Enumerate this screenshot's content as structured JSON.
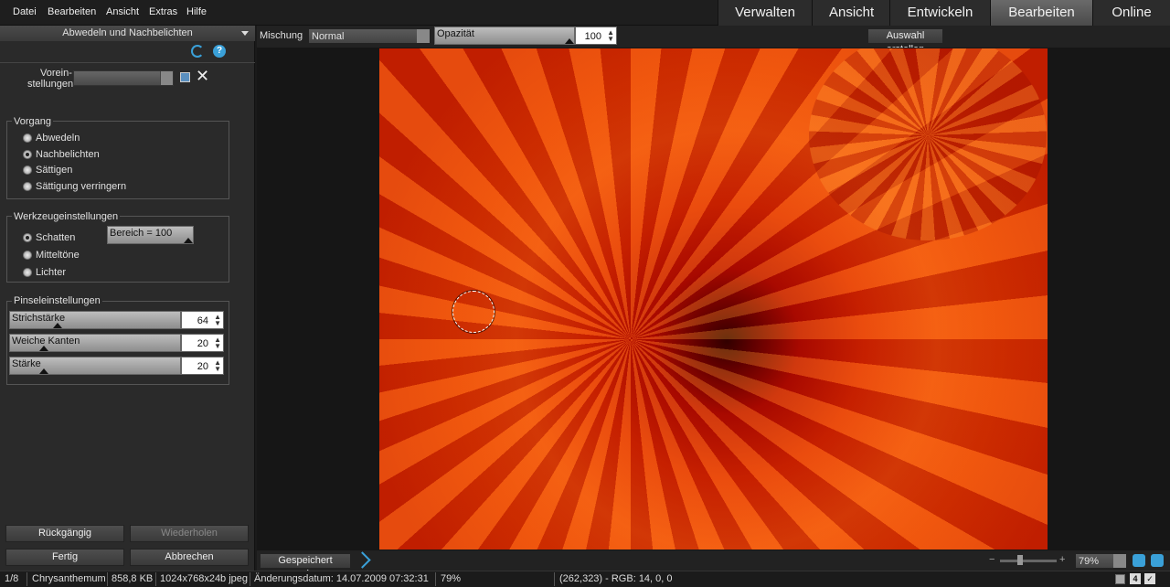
{
  "menu": [
    "Datei",
    "Bearbeiten",
    "Ansicht",
    "Extras",
    "Hilfe"
  ],
  "tabs": [
    "Verwalten",
    "Ansicht",
    "Entwickeln",
    "Bearbeiten",
    "Online"
  ],
  "active_tab": "Bearbeiten",
  "panel": {
    "title": "Abwedeln und Nachbelichten",
    "preset_label_1": "Vorein-",
    "preset_label_2": "stellungen",
    "vorgang": {
      "title": "Vorgang",
      "options": [
        "Abwedeln",
        "Nachbelichten",
        "Sättigen",
        "Sättigung verringern"
      ],
      "selected": "Nachbelichten"
    },
    "werkzeug": {
      "title": "Werkzeugeinstellungen",
      "options": [
        "Schatten",
        "Mitteltöne",
        "Lichter"
      ],
      "selected": "Schatten",
      "range_label": "Bereich = 100"
    },
    "pinsel": {
      "title": "Pinseleinstellungen",
      "sliders": [
        {
          "label": "Strichstärke",
          "value": "64",
          "level": 0.28
        },
        {
          "label": "Weiche Kanten",
          "value": "20",
          "level": 0.2
        },
        {
          "label": "Stärke",
          "value": "20",
          "level": 0.2
        }
      ]
    },
    "buttons": {
      "undo": "Rückgängig",
      "redo": "Wiederholen",
      "done": "Fertig",
      "cancel": "Abbrechen"
    }
  },
  "toolbar": {
    "blend_label": "Mischung",
    "blend_value": "Normal",
    "opacity_label": "Opazität",
    "opacity_value": "100",
    "selection_button": "Auswahl erstellen"
  },
  "bottom": {
    "show_saved": "Gespeichert anzeigen",
    "zoom": "79%"
  },
  "status": {
    "index": "1/8",
    "name": "Chrysanthemum",
    "size": "858,8 KB",
    "dims": "1024x768x24b jpeg",
    "date": "Änderungsdatum: 14.07.2009 07:32:31",
    "zoom": "79%",
    "pixel": "(262,323) - RGB: 14, 0, 0"
  },
  "colors": {
    "accent": "#3aa0d8",
    "panel": "#2a2a2a"
  }
}
